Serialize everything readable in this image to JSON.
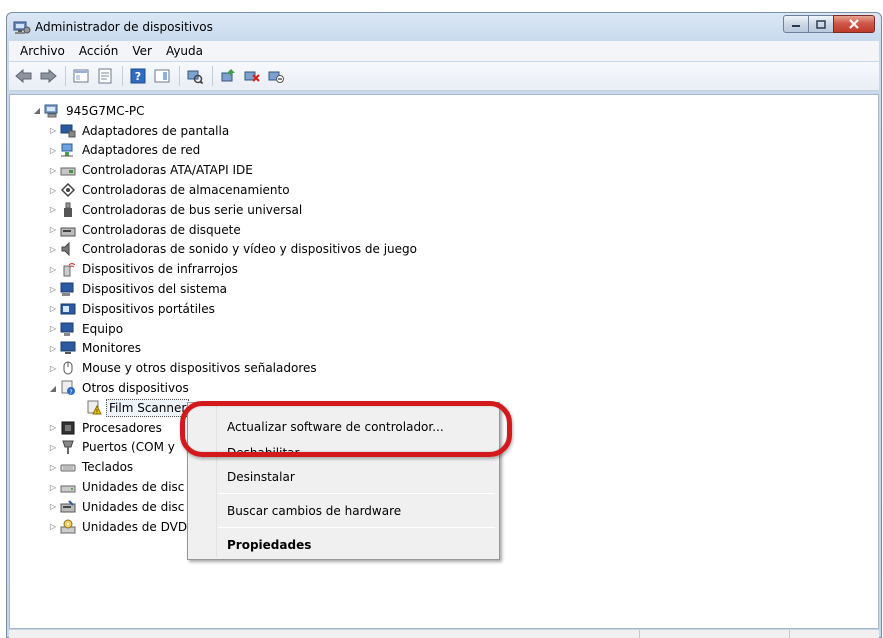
{
  "window": {
    "title": "Administrador de dispositivos",
    "title_icon": "device-manager-icon"
  },
  "menubar": {
    "items": [
      "Archivo",
      "Acción",
      "Ver",
      "Ayuda"
    ]
  },
  "toolbar": {
    "buttons": [
      "back-arrow-icon",
      "forward-arrow-icon",
      "console-tree-icon",
      "properties-icon",
      "help-icon",
      "action-pane-icon",
      "scan-hardware-icon",
      "update-driver-icon",
      "uninstall-icon",
      "disable-icon"
    ]
  },
  "tree": {
    "root": "945G7MC-PC",
    "items": [
      {
        "label": "Adaptadores de pantalla",
        "icon": "display-adapter-icon",
        "expander": "▷"
      },
      {
        "label": "Adaptadores de red",
        "icon": "network-adapter-icon",
        "expander": "▷"
      },
      {
        "label": "Controladoras ATA/ATAPI IDE",
        "icon": "ide-controller-icon",
        "expander": "▷"
      },
      {
        "label": "Controladoras de almacenamiento",
        "icon": "storage-controller-icon",
        "expander": "▷"
      },
      {
        "label": "Controladoras de bus serie universal",
        "icon": "usb-icon",
        "expander": "▷"
      },
      {
        "label": "Controladoras de disquete",
        "icon": "floppy-controller-icon",
        "expander": "▷"
      },
      {
        "label": "Controladoras de sonido y vídeo y dispositivos de juego",
        "icon": "sound-icon",
        "expander": "▷"
      },
      {
        "label": "Dispositivos de infrarrojos",
        "icon": "infrared-icon",
        "expander": "▷"
      },
      {
        "label": "Dispositivos del sistema",
        "icon": "system-device-icon",
        "expander": "▷"
      },
      {
        "label": "Dispositivos portátiles",
        "icon": "portable-device-icon",
        "expander": "▷"
      },
      {
        "label": "Equipo",
        "icon": "computer-icon",
        "expander": "▷"
      },
      {
        "label": "Monitores",
        "icon": "monitor-icon",
        "expander": "▷"
      },
      {
        "label": "Mouse y otros dispositivos señaladores",
        "icon": "mouse-icon",
        "expander": "▷"
      },
      {
        "label": "Otros dispositivos",
        "icon": "unknown-device-icon",
        "expander": "◢"
      },
      {
        "label": "Film Scanner",
        "icon": "warning-device-icon",
        "expander": ""
      },
      {
        "label": "Procesadores",
        "icon": "processor-icon",
        "expander": "▷"
      },
      {
        "label": "Puertos (COM y",
        "icon": "port-icon",
        "expander": "▷"
      },
      {
        "label": "Teclados",
        "icon": "keyboard-icon",
        "expander": "▷"
      },
      {
        "label": "Unidades de disc",
        "icon": "disk-drive-icon",
        "expander": "▷"
      },
      {
        "label": "Unidades de disc",
        "icon": "floppy-drive-icon",
        "expander": "▷"
      },
      {
        "label": "Unidades de DVD",
        "icon": "dvd-drive-icon",
        "expander": "▷"
      }
    ]
  },
  "context_menu": {
    "update": "Actualizar software de controlador...",
    "disable": "Deshabilitar",
    "uninstall": "Desinstalar",
    "scan": "Buscar cambios de hardware",
    "properties": "Propiedades"
  },
  "colors": {
    "highlight_ring": "#d4191c",
    "window_frame": "#c8d9ee"
  }
}
